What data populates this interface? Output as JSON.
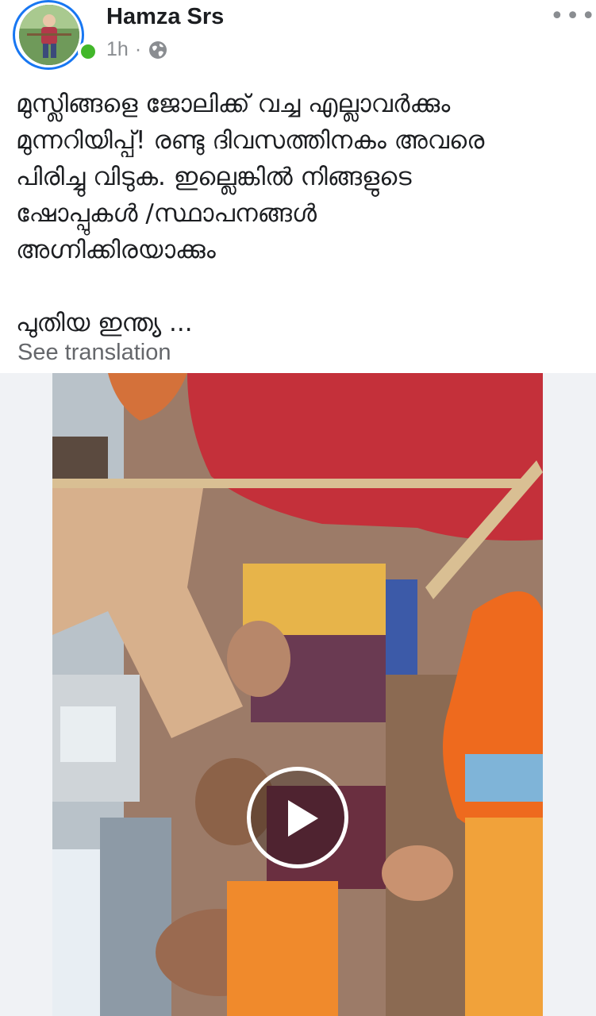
{
  "post": {
    "author": "Hamza Srs",
    "time": "1h",
    "separator": "·",
    "privacy_icon": "globe-icon",
    "more_icon": "more-icon",
    "more_label": "•••",
    "text": "മുസ്ലിങ്ങളെ ജോലിക്ക് വച്ച എല്ലാവർക്കും\nമുന്നറിയിപ്പ്!  രണ്ടു ദിവസത്തിനകം അവരെ\nപിരിച്ചു വിടുക. ഇല്ലെങ്കിൽ നിങ്ങളുടെ\nഷോപ്പുകൾ /സ്ഥാപനങ്ങൾ\nഅഗ്നിക്കിരയാക്കും\n\nപുതിയ ഇന്ത്യ ...",
    "see_translation": "See translation"
  },
  "media": {
    "type": "video",
    "play_icon": "play-icon"
  },
  "colors": {
    "online": "#42b72a",
    "ring": "#1877f2",
    "muted": "#65676b"
  }
}
